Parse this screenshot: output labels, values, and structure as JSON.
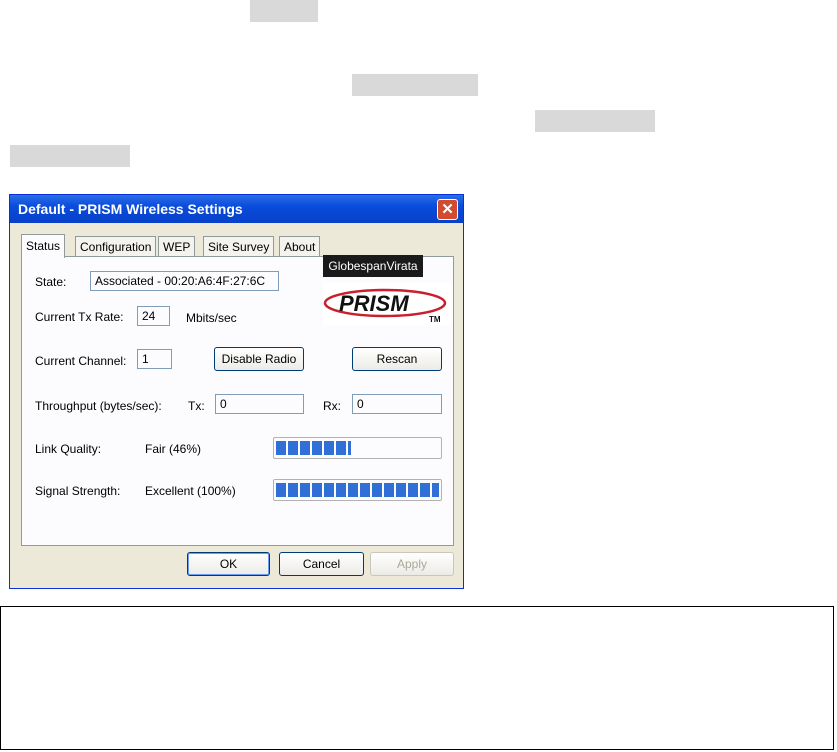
{
  "window": {
    "title": "Default - PRISM Wireless Settings",
    "close_glyph": "✕"
  },
  "tabs": [
    {
      "label": "Status",
      "active": true
    },
    {
      "label": "Configuration",
      "active": false
    },
    {
      "label": "WEP",
      "active": false
    },
    {
      "label": "Site Survey",
      "active": false
    },
    {
      "label": "About",
      "active": false
    }
  ],
  "status": {
    "state_label": "State:",
    "state_value": "Associated - 00:20:A6:4F:27:6C",
    "tx_rate_label": "Current Tx Rate:",
    "tx_rate_value": "24",
    "tx_rate_unit": "Mbits/sec",
    "channel_label": "Current Channel:",
    "channel_value": "1",
    "disable_radio_label": "Disable Radio",
    "rescan_label": "Rescan",
    "throughput_label": "Throughput (bytes/sec):",
    "tx_label": "Tx:",
    "tx_value": "0",
    "rx_label": "Rx:",
    "rx_value": "0",
    "link_quality_label": "Link Quality:",
    "link_quality_value": "Fair (46%)",
    "link_quality_percent": 46,
    "signal_strength_label": "Signal Strength:",
    "signal_strength_value": "Excellent (100%)",
    "signal_strength_percent": 100
  },
  "logos": {
    "globespan": "GlobespanVirata",
    "prism": "PRISM",
    "prism_tm": "TM"
  },
  "buttons": {
    "ok": "OK",
    "cancel": "Cancel",
    "apply": "Apply"
  },
  "colors": {
    "titlebar": "#0a4cdd",
    "progress_fill": "#2f6fd6",
    "close_button": "#d34a2e"
  }
}
